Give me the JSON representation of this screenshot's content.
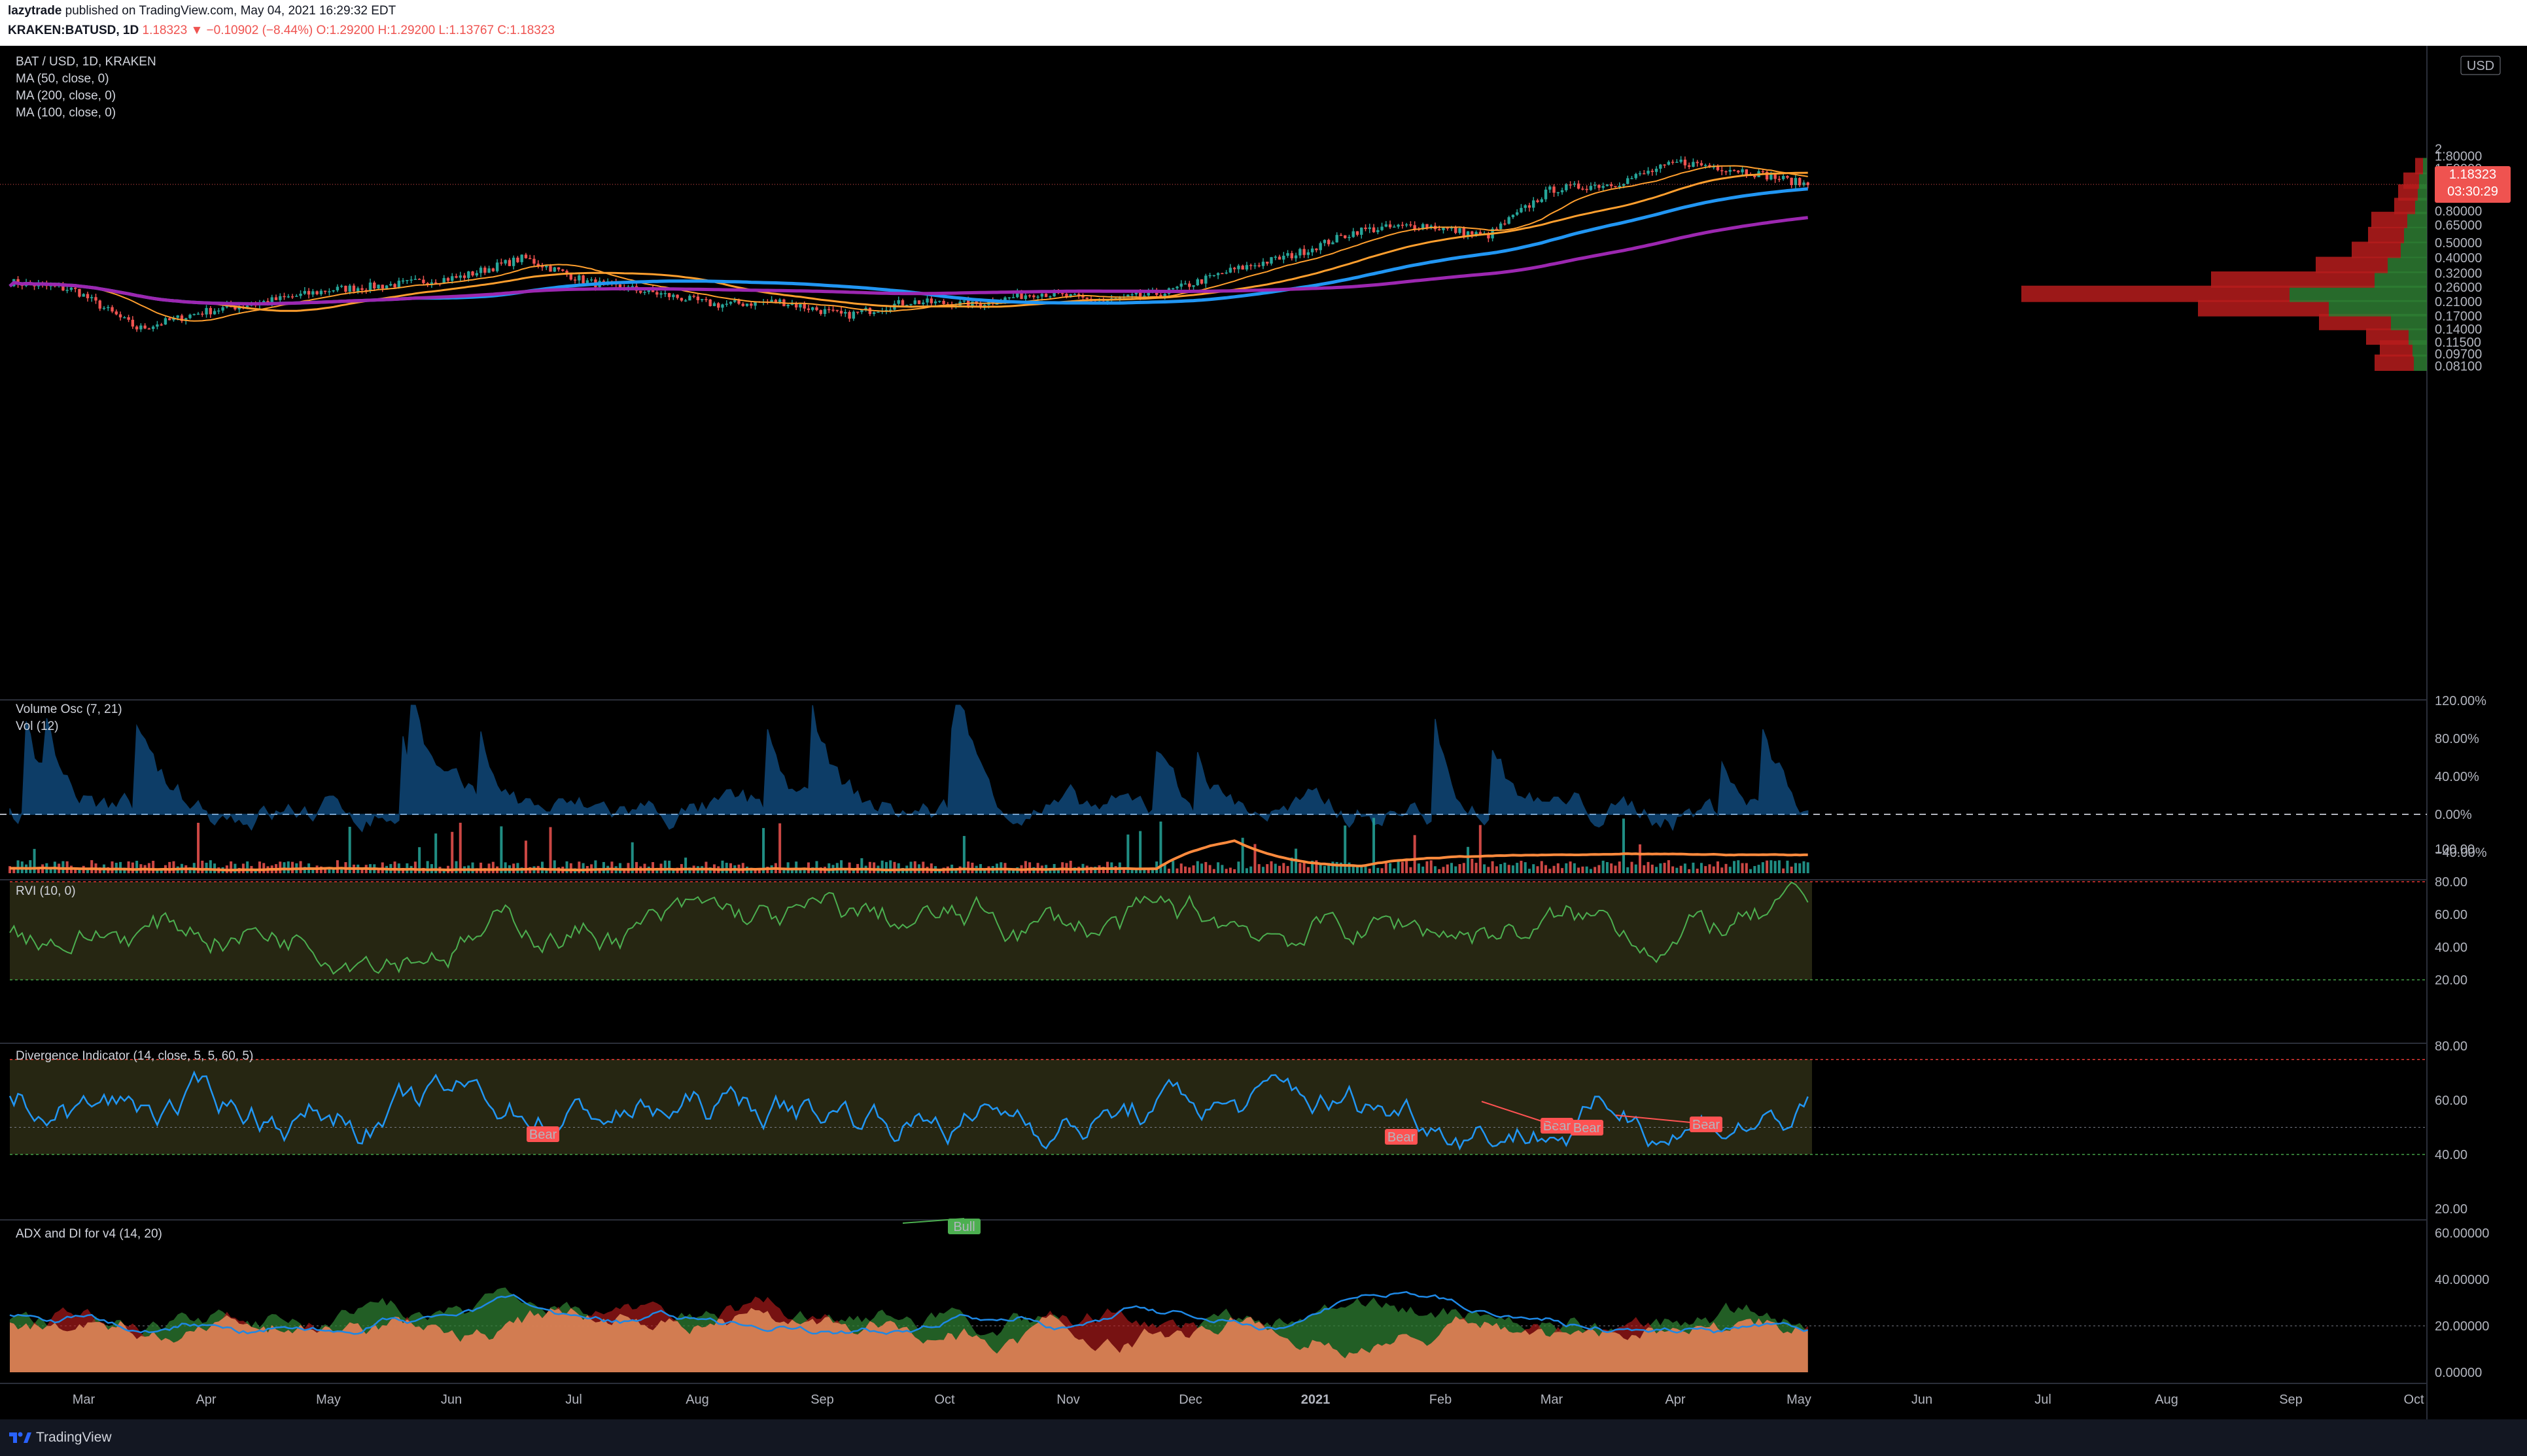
{
  "header": {
    "author": "lazytrade",
    "published_text": " published on TradingView.com, May 04, 2021 16:29:32 EDT",
    "symbol_line": "KRAKEN:BATUSD, 1D",
    "change": "1.18323 ▼ −0.10902 (−8.44%)",
    "ohlc": "O:1.29200 H:1.29200 L:1.13767 C:1.18323"
  },
  "legend": {
    "title": "BAT / USD, 1D, KRAKEN",
    "ma1": "MA (50, close, 0)",
    "ma2": "MA (200, close, 0)",
    "ma3": "MA (100, close, 0)",
    "volosc": "Volume Osc (7, 21)",
    "vol": "Vol (12)",
    "rvi": "RVI (10, 0)",
    "div": "Divergence Indicator (14, close, 5, 5, 60, 5)",
    "adx": "ADX and DI for v4 (14, 20)"
  },
  "price_axis": {
    "currency": "USD",
    "ticks": [
      "2.",
      "1.80000",
      "1.50000",
      "1.00000",
      "0.80000",
      "0.65000",
      "0.50000",
      "0.40000",
      "0.32000",
      "0.26000",
      "0.21000",
      "0.17000",
      "0.14000",
      "0.11500",
      "0.09700",
      "0.08100"
    ],
    "last_price": "1.18323",
    "countdown": "03:30:29"
  },
  "volosc_axis": [
    "120.00%",
    "80.00%",
    "40.00%",
    "0.00%",
    "−40.00%"
  ],
  "rvi_axis": [
    "100.00",
    "80.00",
    "60.00",
    "40.00",
    "20.00"
  ],
  "div_axis": [
    "80.00",
    "60.00",
    "40.00",
    "20.00"
  ],
  "adx_axis": [
    "60.00000",
    "40.00000",
    "20.00000",
    "0.00000"
  ],
  "time_axis": [
    "Mar",
    "Apr",
    "May",
    "Jun",
    "Jul",
    "Aug",
    "Sep",
    "Oct",
    "Nov",
    "Dec",
    "2021",
    "Feb",
    "Mar",
    "Apr",
    "May",
    "Jun",
    "Jul",
    "Aug",
    "Sep",
    "Oct"
  ],
  "div_labels": [
    "Bear",
    "Bear",
    "Bear",
    "Bear",
    "Bear",
    "Bull"
  ],
  "footer": {
    "brand": "TradingView"
  },
  "colors": {
    "up": "#26a69a",
    "down": "#ef5350",
    "ma50": "#ff9f2e",
    "ma100": "#9c27b0",
    "ma200": "#2196f3",
    "ema_fast": "#f9a825",
    "rvi": "#4caf50",
    "div": "#2196f3"
  },
  "chart_data": {
    "type": "line",
    "ticker": "BAT/USD",
    "interval": "1D",
    "x": [
      "2020-03",
      "2020-04",
      "2020-05",
      "2020-06",
      "2020-07",
      "2020-08",
      "2020-09",
      "2020-10",
      "2020-11",
      "2020-12",
      "2021-01",
      "2021-02",
      "2021-03",
      "2021-04",
      "2021-05"
    ],
    "series": [
      {
        "name": "BAT/USD",
        "values": [
          0.16,
          0.17,
          0.21,
          0.22,
          0.26,
          0.28,
          0.32,
          0.24,
          0.18,
          0.23,
          0.22,
          0.42,
          0.72,
          1.5,
          1.18
        ]
      },
      {
        "name": "MA (50, close, 0)",
        "values": [
          0.24,
          0.17,
          0.18,
          0.21,
          0.23,
          0.26,
          0.3,
          0.26,
          0.21,
          0.21,
          0.24,
          0.3,
          0.5,
          0.95,
          1.2
        ]
      },
      {
        "name": "MA (200, close, 0)",
        "values": [
          0.22,
          0.21,
          0.2,
          0.21,
          0.21,
          0.22,
          0.23,
          0.23,
          0.23,
          0.24,
          0.24,
          0.24,
          0.3,
          0.45,
          0.57
        ]
      },
      {
        "name": "MA (100, close, 0)",
        "values": [
          0.21,
          0.2,
          0.2,
          0.19,
          0.2,
          0.23,
          0.26,
          0.27,
          0.25,
          0.23,
          0.23,
          0.25,
          0.35,
          0.7,
          0.9
        ]
      }
    ],
    "ylim": [
      0.081,
      2.0
    ],
    "log_scale": true,
    "last_price": 1.18323
  }
}
